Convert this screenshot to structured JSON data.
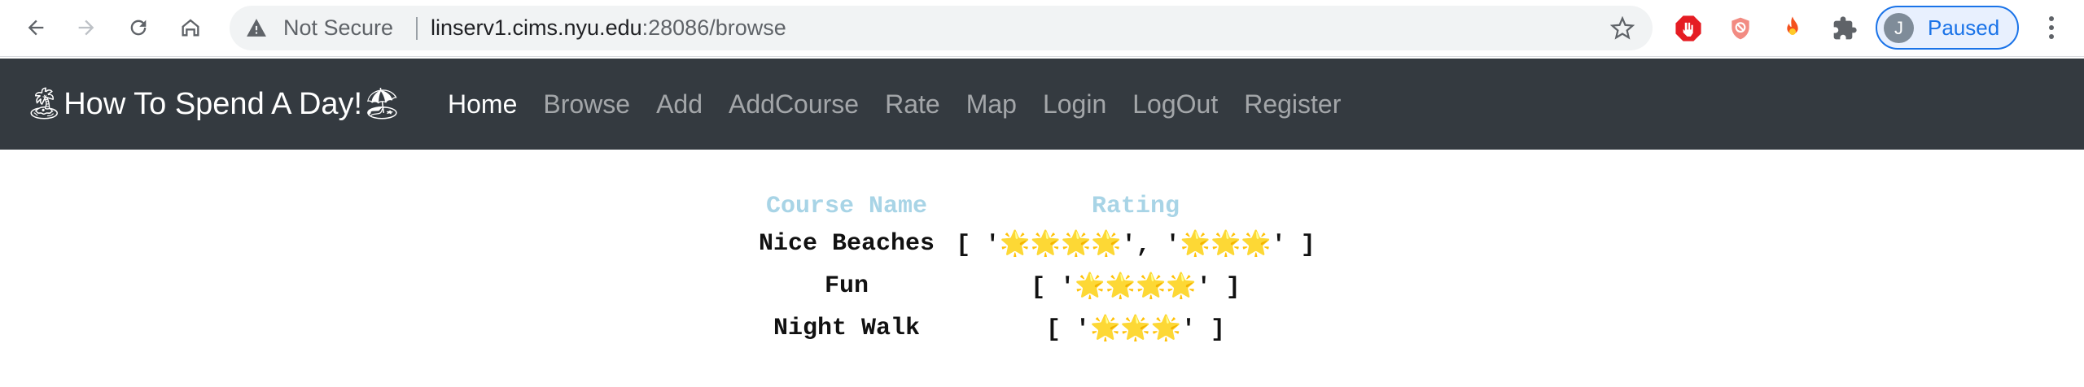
{
  "browser": {
    "omnibox": {
      "security_label": "Not Secure",
      "url_host": "linserv1.cims.nyu.edu",
      "url_rest": ":28086/browse"
    },
    "profile": {
      "initial": "J",
      "status": "Paused"
    },
    "colors": {
      "accent": "#1a73e8",
      "toolbar_icon": "#5f6368"
    }
  },
  "site": {
    "brand": "🏝How To Spend A Day!🏖",
    "nav": [
      {
        "label": "Home",
        "active": true
      },
      {
        "label": "Browse",
        "active": false
      },
      {
        "label": "Add",
        "active": false
      },
      {
        "label": "AddCourse",
        "active": false
      },
      {
        "label": "Rate",
        "active": false
      },
      {
        "label": "Map",
        "active": false
      },
      {
        "label": "Login",
        "active": false
      },
      {
        "label": "LogOut",
        "active": false
      },
      {
        "label": "Register",
        "active": false
      }
    ],
    "colors": {
      "navbar_bg": "#343a40",
      "header_text": "#a8d4e6"
    }
  },
  "courses": {
    "headers": {
      "name": "Course Name",
      "rating": "Rating"
    },
    "rows": [
      {
        "name": "Nice Beaches",
        "rating": "[ '🌟🌟🌟🌟', '🌟🌟🌟' ]"
      },
      {
        "name": "Fun",
        "rating": "[ '🌟🌟🌟🌟' ]"
      },
      {
        "name": "Night Walk",
        "rating": "[ '🌟🌟🌟' ]"
      }
    ]
  }
}
